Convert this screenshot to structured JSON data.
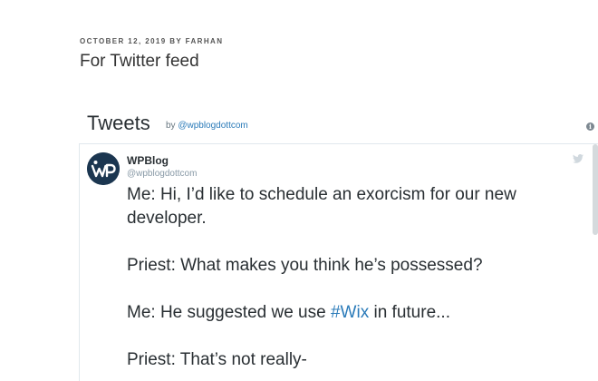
{
  "post": {
    "date": "OCTOBER 12, 2019",
    "by_label": "BY",
    "author": "FARHAN",
    "title": "For Twitter feed"
  },
  "widget": {
    "title": "Tweets",
    "by_label": "by",
    "by_handle": "@wpblogdottcom",
    "info_icon": "info-icon"
  },
  "tweet": {
    "avatar_text": "WP",
    "name": "WPBlog",
    "handle": "@wpblogdottcom",
    "brand_icon": "twitter-bird-icon",
    "line1": "Me: Hi, I’d like to schedule an exorcism for our new developer.",
    "line2": "Priest: What makes you think he’s possessed?",
    "line3_prefix": "Me: He suggested we use ",
    "line3_hashtag": "#Wix",
    "line3_suffix": " in future...",
    "line4": "Priest: That’s not really-"
  },
  "colors": {
    "link": "#2b7bb9",
    "text": "#292f33",
    "muted": "#8899a6",
    "avatar_bg": "#1b3650",
    "border": "#e1e8ed"
  }
}
